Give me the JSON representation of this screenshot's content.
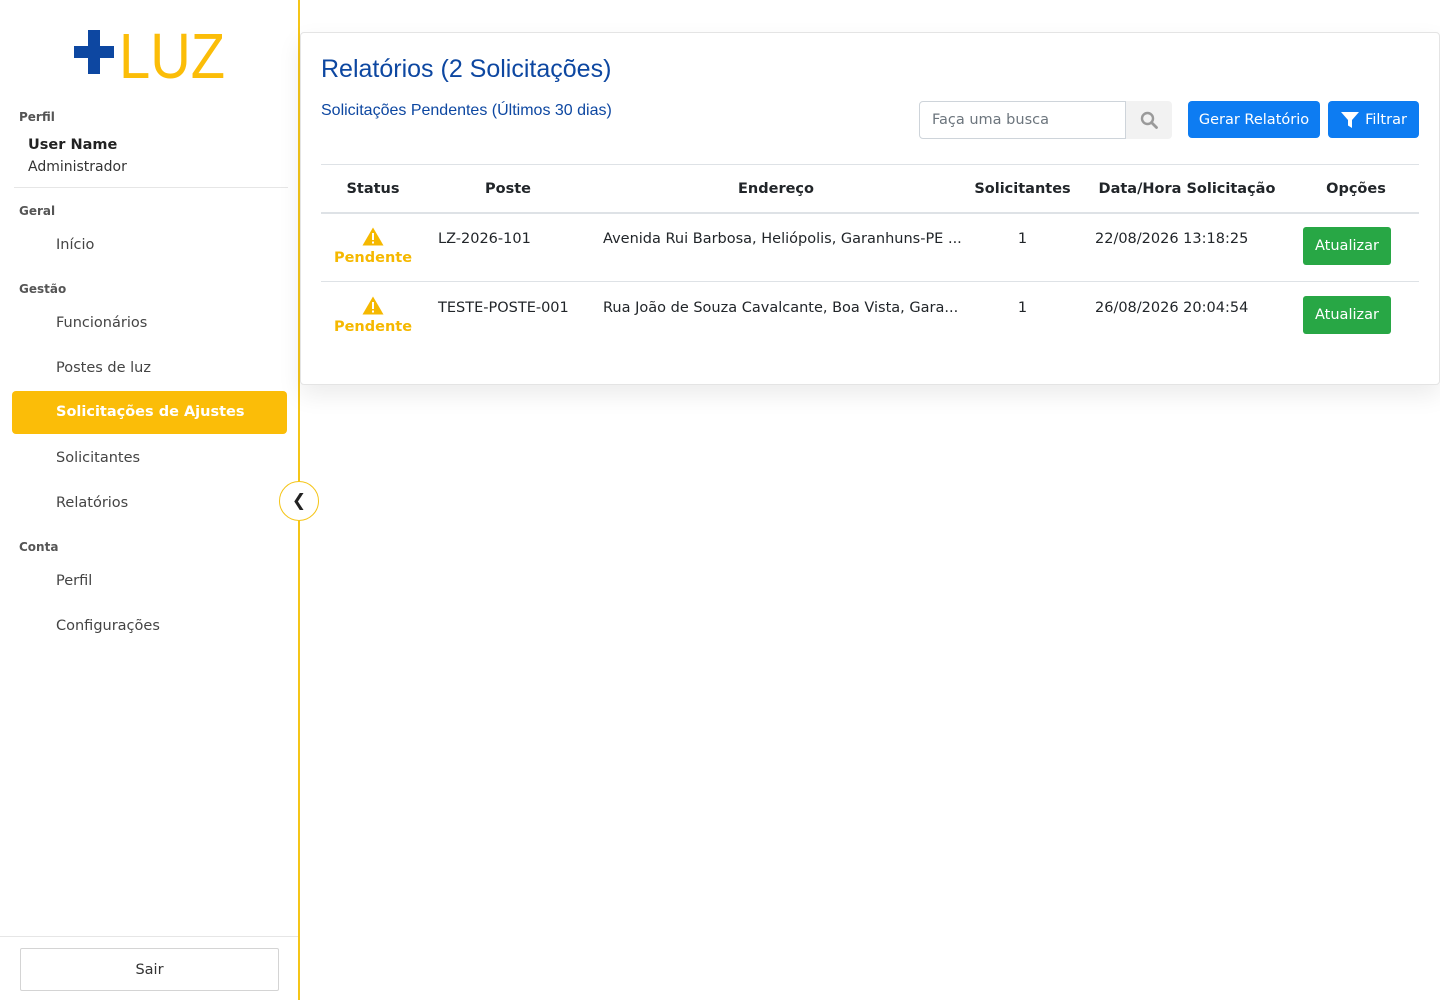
{
  "brand": {
    "logo_text": "+LUZ",
    "colors": {
      "plus": "#0d47a1",
      "luz": "#fbbd08"
    }
  },
  "sidebar": {
    "profile_section": "Perfil",
    "user_name": "User Name",
    "user_role": "Administrador",
    "sections": [
      {
        "title": "Geral",
        "items": [
          {
            "label": "Início"
          }
        ]
      },
      {
        "title": "Gestão",
        "items": [
          {
            "label": "Funcionários"
          },
          {
            "label": "Postes de luz"
          },
          {
            "label": "Solicitações de Ajustes",
            "active": true
          },
          {
            "label": "Solicitantes"
          },
          {
            "label": "Relatórios"
          }
        ]
      },
      {
        "title": "Conta",
        "items": [
          {
            "label": "Perfil"
          },
          {
            "label": "Configurações"
          }
        ]
      }
    ],
    "collapse_glyph": "❮",
    "logout_label": "Sair"
  },
  "main": {
    "title": "Relatórios (2 Solicitações)",
    "subtitle": "Solicitações Pendentes (Últimos 30 dias)",
    "search_placeholder": "Faça uma busca",
    "search_icon": "search-icon",
    "report_button": "Gerar Relatório",
    "filter_button": "Filtrar",
    "filter_icon": "filter-icon",
    "table": {
      "columns": [
        "Status",
        "Poste",
        "Endereço",
        "Solicitantes",
        "Data/Hora Solicitação",
        "Opções"
      ],
      "rows": [
        {
          "status": "Pendente",
          "status_icon": "warning-icon",
          "poste": "LZ-2026-101",
          "endereco": "Avenida Rui Barbosa, Heliópolis, Garanhuns-PE ...",
          "solicitantes": "1",
          "datahora": "22/08/2026 13:18:25",
          "action": "Atualizar"
        },
        {
          "status": "Pendente",
          "status_icon": "warning-icon",
          "poste": "TESTE-POSTE-001",
          "endereco": "Rua João de Souza Cavalcante, Boa Vista, Gara...",
          "solicitantes": "1",
          "datahora": "26/08/2026 20:04:54",
          "action": "Atualizar"
        }
      ]
    },
    "colors": {
      "primary": "#0d7cf2",
      "success": "#28a745",
      "warning": "#f5b800",
      "title": "#0d47a1"
    }
  }
}
